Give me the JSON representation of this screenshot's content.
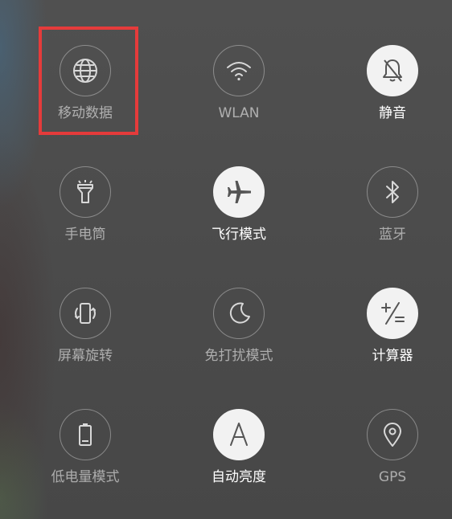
{
  "tiles": {
    "mobile_data": {
      "label": "移动数据",
      "icon": "globe-icon",
      "active": false
    },
    "wlan": {
      "label": "WLAN",
      "icon": "wifi-icon",
      "active": false
    },
    "silent": {
      "label": "静音",
      "icon": "bell-off-icon",
      "active": true
    },
    "flashlight": {
      "label": "手电筒",
      "icon": "flashlight-icon",
      "active": false
    },
    "airplane": {
      "label": "飞行模式",
      "icon": "airplane-icon",
      "active": true
    },
    "bluetooth": {
      "label": "蓝牙",
      "icon": "bluetooth-icon",
      "active": false
    },
    "rotation": {
      "label": "屏幕旋转",
      "icon": "rotate-icon",
      "active": false
    },
    "dnd": {
      "label": "免打扰模式",
      "icon": "moon-icon",
      "active": false
    },
    "calculator": {
      "label": "计算器",
      "icon": "calculator-icon",
      "active": true
    },
    "battery_saver": {
      "label": "低电量模式",
      "icon": "battery-icon",
      "active": false
    },
    "auto_brightness": {
      "label": "自动亮度",
      "icon": "brightness-a-icon",
      "active": true
    },
    "gps": {
      "label": "GPS",
      "icon": "location-pin-icon",
      "active": false
    }
  },
  "colors": {
    "active_bg": "#f2f2f2",
    "active_icon": "#555555",
    "inactive_stroke": "#d8d8d8",
    "highlight": "#e53b3b"
  }
}
